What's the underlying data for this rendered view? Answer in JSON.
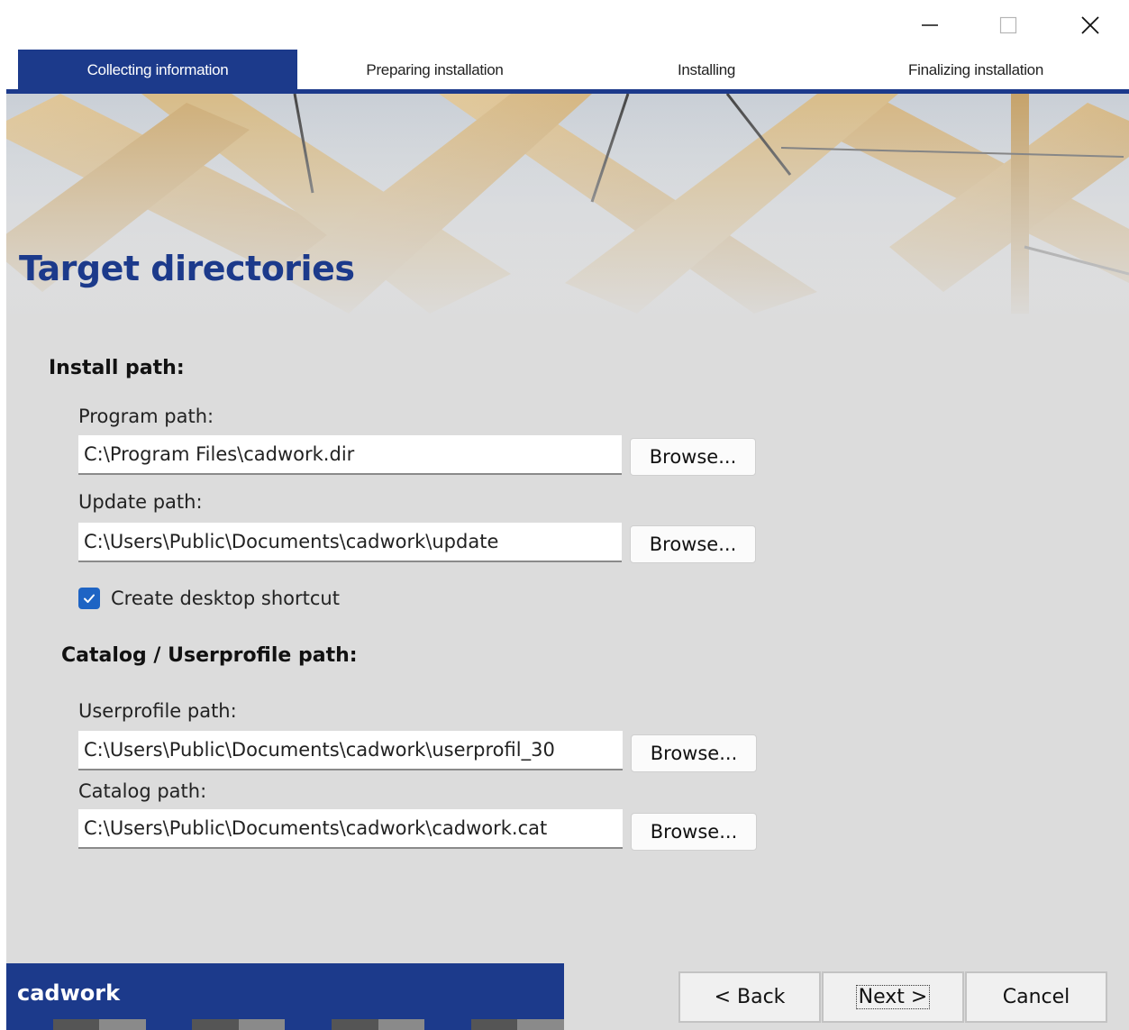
{
  "steps": [
    {
      "label": "Collecting information",
      "active": true
    },
    {
      "label": "Preparing installation",
      "active": false
    },
    {
      "label": "Installing",
      "active": false
    },
    {
      "label": "Finalizing installation",
      "active": false
    }
  ],
  "page": {
    "title": "Target directories"
  },
  "install": {
    "section_label": "Install path:",
    "program_label": "Program path:",
    "program_value": "C:\\Program Files\\cadwork.dir",
    "update_label": "Update path:",
    "update_value": "C:\\Users\\Public\\Documents\\cadwork\\update",
    "shortcut_label": "Create desktop shortcut",
    "shortcut_checked": true
  },
  "catalog": {
    "section_label": "Catalog / Userprofile path:",
    "userprofile_label": "Userprofile path:",
    "userprofile_value": "C:\\Users\\Public\\Documents\\cadwork\\userprofil_30",
    "catalog_label": "Catalog path:",
    "catalog_value": "C:\\Users\\Public\\Documents\\cadwork\\cadwork.cat"
  },
  "browse_label": "Browse...",
  "footer": {
    "brand": "cadwork",
    "back_label": "< Back",
    "next_label": "Next >",
    "cancel_label": "Cancel"
  },
  "colors": {
    "accent": "#1c3a8b",
    "checkbox": "#1e64c4"
  },
  "icons": {
    "minimize": "minimize-icon",
    "maximize": "maximize-icon",
    "close": "close-icon",
    "check": "check-icon"
  }
}
